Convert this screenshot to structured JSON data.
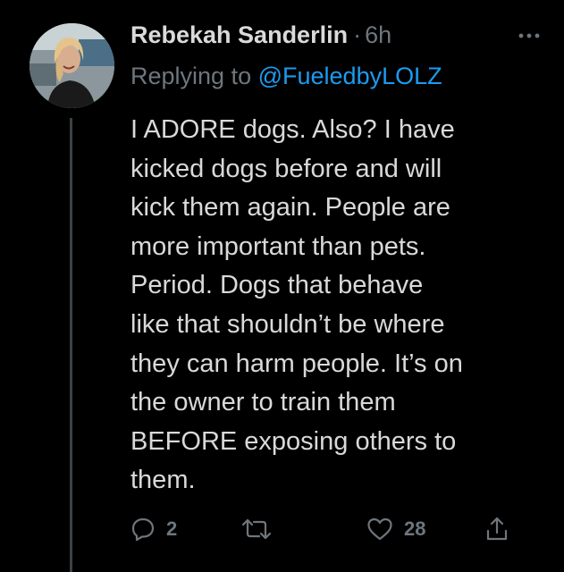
{
  "tweet": {
    "author_name": "Rebekah Sanderlin",
    "separator": "·",
    "time": "6h",
    "replying_prefix": "Replying to",
    "replying_handle": "@FueledbyLOLZ",
    "body_lines": [
      "I ADORE dogs. Also? I have",
      "kicked dogs before and will",
      "kick them again. People are",
      "more important than pets.",
      "Period. Dogs that behave",
      "like that shouldn’t be where",
      "they can harm people. It’s on",
      "the owner to train them",
      "BEFORE exposing others to",
      "them."
    ],
    "actions": {
      "reply_count": "2",
      "retweet_count": "",
      "like_count": "28"
    }
  },
  "icons": {
    "more": "more-horizontal-icon",
    "reply": "reply-icon",
    "retweet": "retweet-icon",
    "like": "heart-icon",
    "share": "share-icon"
  },
  "colors": {
    "background": "#000000",
    "text": "#d9d9d9",
    "secondary": "#6e767d",
    "accent": "#1d9bf0",
    "thread_line": "#3c4146"
  }
}
